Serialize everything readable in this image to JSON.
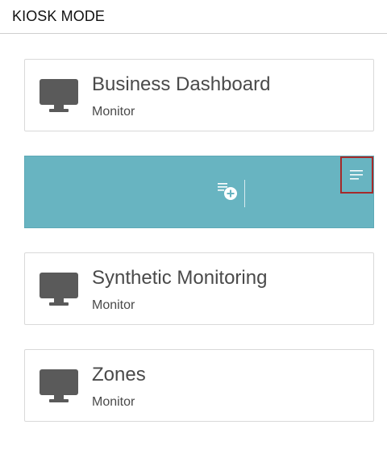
{
  "header": {
    "title": "KIOSK MODE"
  },
  "cards": [
    {
      "title": "Business Dashboard",
      "subtitle": "Monitor",
      "icon": "monitor-icon"
    },
    {
      "title": "Synthetic Monitoring",
      "subtitle": "Monitor",
      "icon": "monitor-icon"
    },
    {
      "title": "Zones",
      "subtitle": "Monitor",
      "icon": "monitor-icon"
    }
  ],
  "active_card": {
    "actions": [
      {
        "icon": "add-to-list-icon"
      },
      {
        "icon": "menu-icon",
        "highlighted": true
      }
    ],
    "background": "#68b4c1"
  },
  "colors": {
    "highlight": "#a52a2a",
    "icon": "#5a5a5a"
  }
}
